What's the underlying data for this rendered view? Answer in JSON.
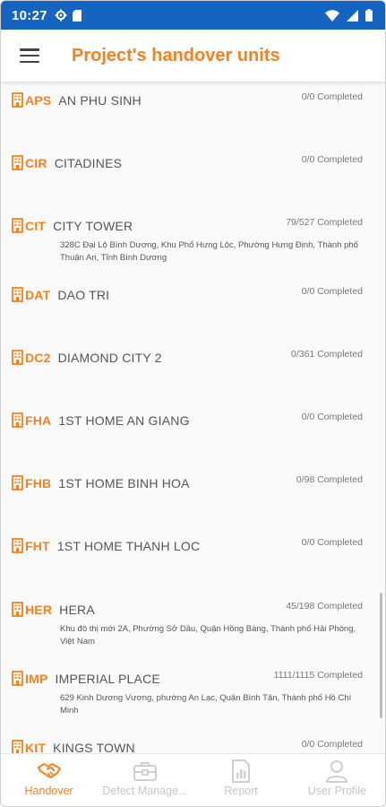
{
  "status_bar": {
    "time": "10:27"
  },
  "header": {
    "title": "Project's handover units"
  },
  "projects": [
    {
      "code": "APS",
      "name": "AN PHU SINH",
      "status": "0/0 Completed",
      "address": ""
    },
    {
      "code": "CIR",
      "name": "CITADINES",
      "status": "0/0 Completed",
      "address": ""
    },
    {
      "code": "CIT",
      "name": "CITY TOWER",
      "status": "79/527 Completed",
      "address": "328C Đại Lộ Bình Dương, Khu Phố Hưng Lộc, Phường Hưng Định, Thành phố Thuận An, Tỉnh Bình Dương"
    },
    {
      "code": "DAT",
      "name": "DAO TRI",
      "status": "0/0 Completed",
      "address": ""
    },
    {
      "code": "DC2",
      "name": "DIAMOND CITY 2",
      "status": "0/361 Completed",
      "address": ""
    },
    {
      "code": "FHA",
      "name": "1ST HOME AN GIANG",
      "status": "0/0 Completed",
      "address": ""
    },
    {
      "code": "FHB",
      "name": "1ST HOME BINH HOA",
      "status": "0/98 Completed",
      "address": ""
    },
    {
      "code": "FHT",
      "name": "1ST HOME THANH LOC",
      "status": "0/0 Completed",
      "address": ""
    },
    {
      "code": "HER",
      "name": "HERA",
      "status": "45/198 Completed",
      "address": "Khu đô thị mới 2A, Phường Sở Dầu, Quận Hồng Bàng, Thành phố Hải Phòng, Việt Nam"
    },
    {
      "code": "IMP",
      "name": "IMPERIAL PLACE",
      "status": "1111/1115 Completed",
      "address": "629 Kinh Dương Vương, phường An Lạc, Quận Bình Tân, Thành phố Hồ Chí Minh"
    },
    {
      "code": "KIT",
      "name": "KINGS TOWN",
      "status": "0/0 Completed",
      "address": ""
    }
  ],
  "bottom_nav": {
    "handover": "Handover",
    "defect": "Defect Manage...",
    "report": "Report",
    "profile": "User Profile"
  },
  "colors": {
    "accent": "#f5821f",
    "status_bar": "#1565c0"
  }
}
